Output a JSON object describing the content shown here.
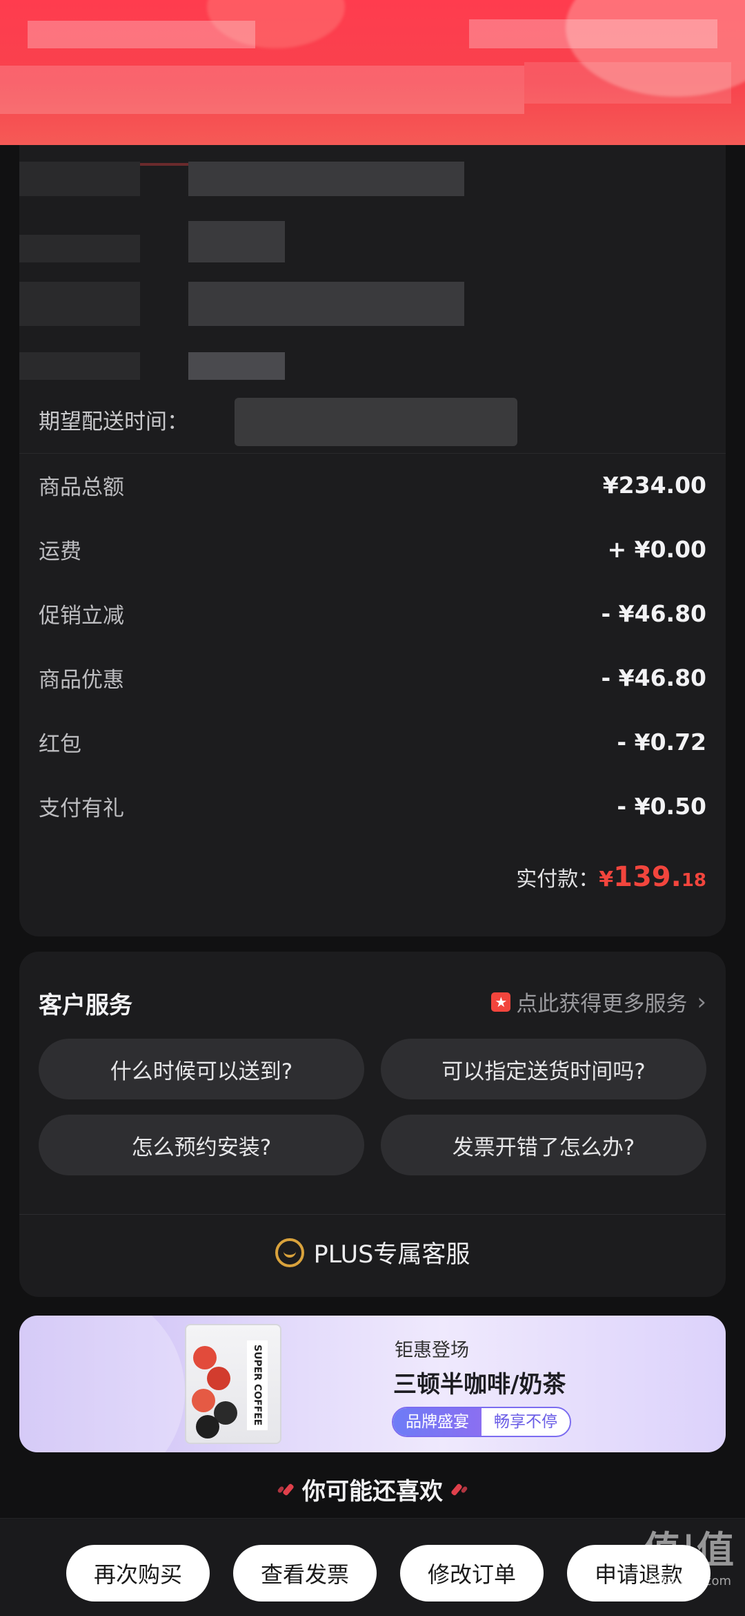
{
  "delivery": {
    "expect_label": "期望配送时间："
  },
  "price": {
    "rows": [
      {
        "label": "商品总额",
        "value": "¥234.00"
      },
      {
        "label": "运费",
        "value": "+ ¥0.00"
      },
      {
        "label": "促销立减",
        "value": "- ¥46.80"
      },
      {
        "label": "商品优惠",
        "value": "- ¥46.80"
      },
      {
        "label": "红包",
        "value": "- ¥0.72"
      },
      {
        "label": "支付有礼",
        "value": "- ¥0.50"
      }
    ],
    "paid_label": "实付款：",
    "paid_currency": "¥",
    "paid_int": "139.",
    "paid_dec": "18"
  },
  "service": {
    "title": "客户服务",
    "more": "点此获得更多服务",
    "more_badge": "★",
    "chevron": "›",
    "questions": [
      "什么时候可以送到?",
      "可以指定送货时间吗?",
      "怎么预约安装?",
      "发票开错了怎么办?"
    ],
    "plus_service": "PLUS专属客服"
  },
  "ad": {
    "subtitle": "钜惠登场",
    "title": "三顿半咖啡/奶茶",
    "pill_left": "品牌盛宴",
    "pill_right": "畅享不停",
    "product_label": "SUPER COFFEE"
  },
  "recommend": {
    "title": "你可能还喜欢"
  },
  "actions": {
    "rebuy": "再次购买",
    "invoice": "查看发票",
    "modify": "修改订单",
    "refund": "申请退款"
  },
  "watermark": {
    "logo": "值|值",
    "site": "zhizhizhi.com"
  },
  "colors": {
    "accent_red": "#f2453d",
    "header_red": "#ff3c4e",
    "card_bg": "#1c1c1e",
    "page_bg": "#111112",
    "plus_gold": "#d9a23c"
  }
}
